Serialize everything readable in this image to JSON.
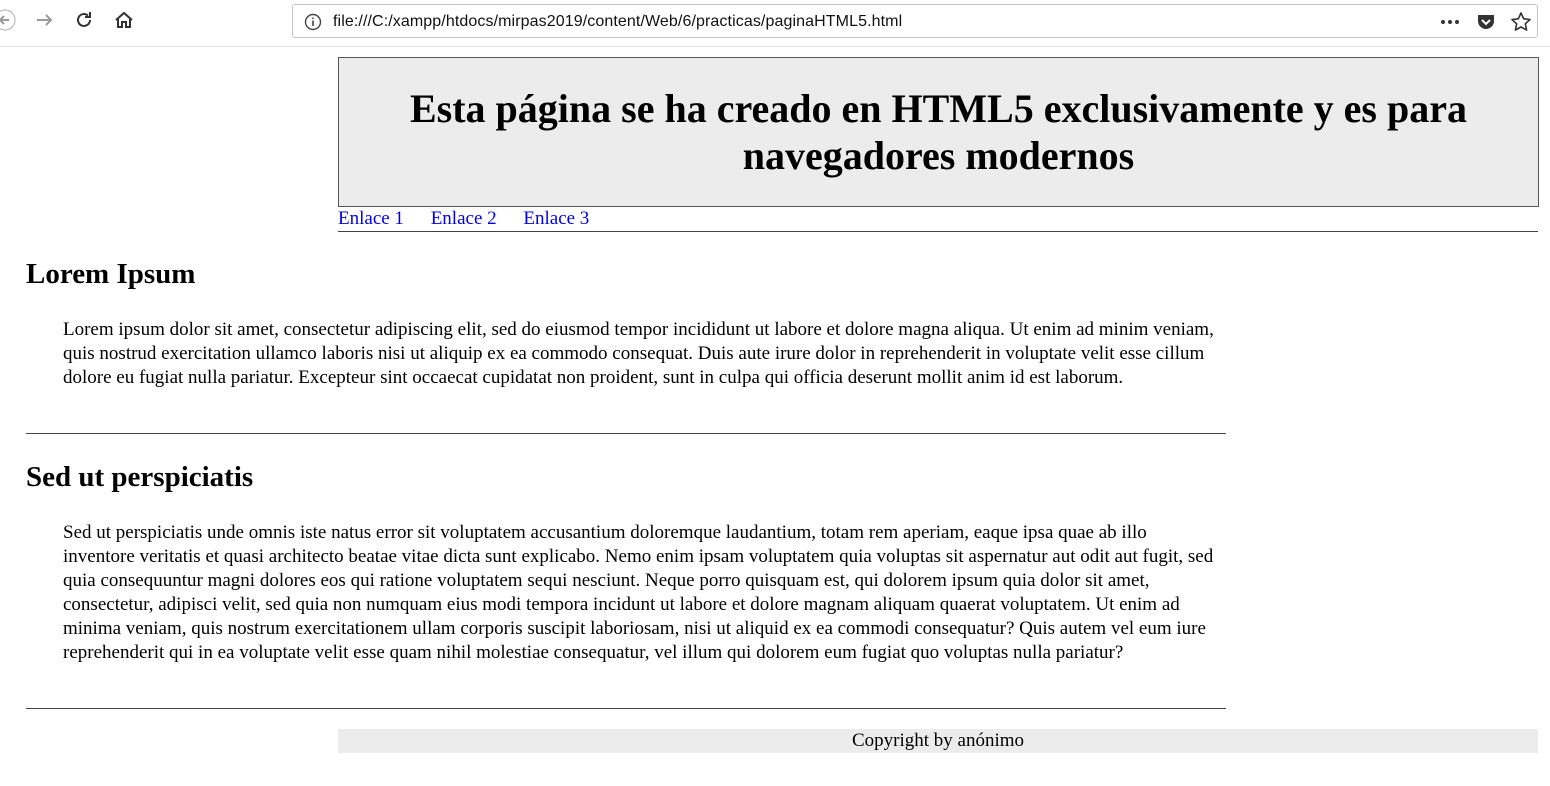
{
  "browser": {
    "url": "file:///C:/xampp/htdocs/mirpas2019/content/Web/6/practicas/paginaHTML5.html",
    "icons": [
      "back-icon",
      "forward-icon",
      "reload-icon",
      "home-icon",
      "info-icon",
      "more-icon",
      "pocket-icon",
      "bookmark-star-icon"
    ]
  },
  "header": {
    "title": "Esta página se ha creado en HTML5 exclusivamente y es para navegadores modernos"
  },
  "nav": {
    "links": [
      "Enlace 1",
      "Enlace 2",
      "Enlace 3"
    ],
    "link_color": "#0000ee"
  },
  "articles": [
    {
      "title": "Lorem Ipsum",
      "body": "Lorem ipsum dolor sit amet, consectetur adipiscing elit, sed do eiusmod tempor incididunt ut labore et dolore magna aliqua. Ut enim ad minim veniam, quis nostrud exercitation ullamco laboris nisi ut aliquip ex ea commodo consequat. Duis aute irure dolor in reprehenderit in voluptate velit esse cillum dolore eu fugiat nulla pariatur. Excepteur sint occaecat cupidatat non proident, sunt in culpa qui officia deserunt mollit anim id est laborum."
    },
    {
      "title": "Sed ut perspiciatis",
      "body": "Sed ut perspiciatis unde omnis iste natus error sit voluptatem accusantium doloremque laudantium, totam rem aperiam, eaque ipsa quae ab illo inventore veritatis et quasi architecto beatae vitae dicta sunt explicabo. Nemo enim ipsam voluptatem quia voluptas sit aspernatur aut odit aut fugit, sed quia consequuntur magni dolores eos qui ratione voluptatem sequi nesciunt. Neque porro quisquam est, qui dolorem ipsum quia dolor sit amet, consectetur, adipisci velit, sed quia non numquam eius modi tempora incidunt ut labore et dolore magnam aliquam quaerat voluptatem. Ut enim ad minima veniam, quis nostrum exercitationem ullam corporis suscipit laboriosam, nisi ut aliquid ex ea commodi consequatur? Quis autem vel eum iure reprehenderit qui in ea voluptate velit esse quam nihil molestiae consequatur, vel illum qui dolorem eum fugiat quo voluptas nulla pariatur?"
    }
  ],
  "footer": {
    "text": "Copyright by anónimo",
    "background": "#ececec"
  }
}
